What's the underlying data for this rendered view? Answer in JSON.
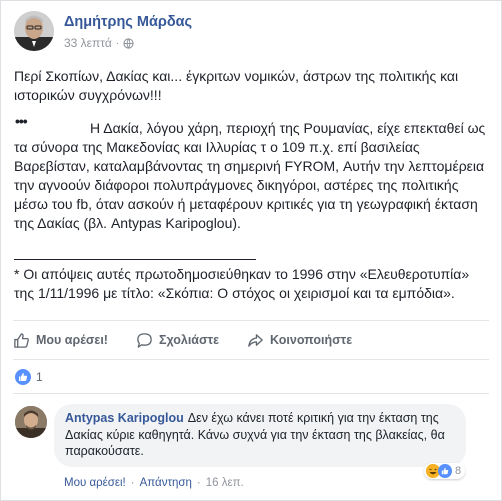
{
  "post": {
    "author": "Δημήτρης Μάρδας",
    "time": "33 λεπτά",
    "separator": "·",
    "paragraph1": "Περί Σκοπίων, Δακίας και... έγκριτων νομικών, άστρων της πολιτικής και ιστορικών συγχρόνων!!!",
    "dots": "•••",
    "paragraph2": "Η Δακία, λόγου χάρη, περιοχή της Ρουμανίας, είχε επεκταθεί ως τα σύνορα της Μακεδονίας και Ιλλυρίας τ ο 109 π.χ. επί βασιλείας Βαρεβίσταν, καταλαμβάνοντας τη σημερινή FYROM, Αυτήν την λεπτομέρεια την αγνοούν διάφοροι πολυπράγμονες δικηγόροι, αστέρες της πολιτικής μέσω του fb, όταν ασκούν ή μεταφέρουν κριτικές για τη γεωγραφική έκταση της Δακίας (βλ. Antypas Karipoglou).",
    "paragraph3": "* Οι απόψεις αυτές πρωτοδημοσιεύθηκαν το 1996 στην «Ελευθεροτυπία» της 1/11/1996 με τίτλο: «Σκόπια: Ο στόχος οι χειρισμοί και τα εμπόδια».",
    "reaction_count": "1"
  },
  "actions": {
    "like": "Μου αρέσει!",
    "comment": "Σχολιάστε",
    "share": "Κοινοποιήστε"
  },
  "comment": {
    "author": "Antypas Karipoglou",
    "text": "Δεν έχω κάνει ποτέ κριτική για την έκταση της Δακίας κύριε καθηγητά. Κάνω συχνά για την έκταση της βλακείας, θα παρακούσατε.",
    "reaction_count": "8",
    "like": "Μου αρέσει!",
    "reply": "Απάντηση",
    "time": "16 λεπ.",
    "separator": "·"
  },
  "colors": {
    "link": "#365899",
    "meta": "#90949c",
    "like_blue": "#5890ff"
  },
  "icons": [
    "globe-icon",
    "like-thumb-icon",
    "comment-bubble-icon",
    "share-arrow-icon",
    "haha-emoji-icon",
    "like-reaction-icon"
  ]
}
